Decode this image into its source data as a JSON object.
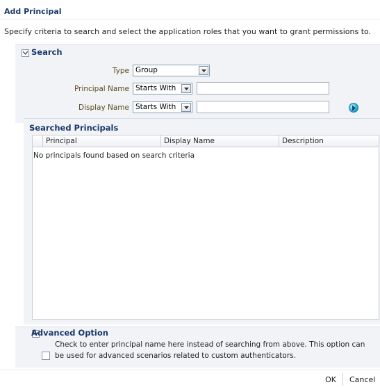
{
  "dialog": {
    "title": "Add Principal",
    "description": "Specify criteria to search and select the application roles that you want to grant permissions to."
  },
  "search": {
    "header": "Search",
    "type_label": "Type",
    "type_value": "Group",
    "principal_name_label": "Principal Name",
    "principal_name_operator": "Starts With",
    "principal_name_value": "",
    "display_name_label": "Display Name",
    "display_name_operator": "Starts With",
    "display_name_value": ""
  },
  "results": {
    "header": "Searched Principals",
    "columns": [
      "Principal",
      "Display Name",
      "Description"
    ],
    "empty_message": "No principals found based on search criteria"
  },
  "advanced": {
    "header": "Advanced Option",
    "checkbox_label": "Check to enter principal name here instead of searching from above. This option can be used for advanced scenarios related to custom authenticators.",
    "checked": false
  },
  "buttons": {
    "ok": "OK",
    "cancel": "Cancel"
  },
  "colors": {
    "header_text": "#1b3a6b",
    "panel_bg": "#f1f3f6",
    "label_text": "#5c4a1e",
    "go_button": "#2ba7d8"
  },
  "icons": {
    "search_toggle": "chevron-down-icon",
    "advanced_toggle": "chevron-down-icon",
    "go": "arrow-right-circle-icon"
  }
}
